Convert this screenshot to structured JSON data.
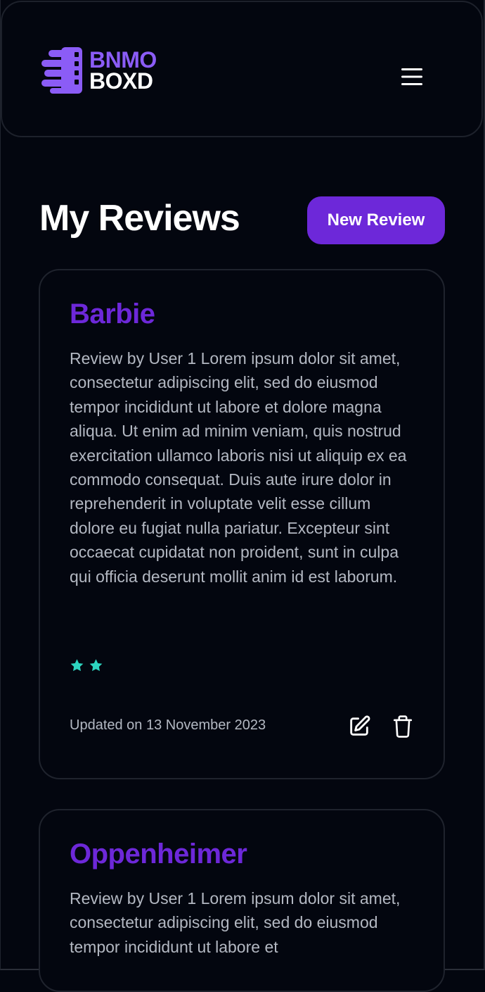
{
  "app": {
    "logo_line_1": "BNMO",
    "logo_line_2": "BOXD",
    "brand_color": "#8b5cf6",
    "menu_icon": "hamburger-menu-icon"
  },
  "page": {
    "title": "My Reviews",
    "new_review_label": "New Review",
    "accent_color": "#6d28d9"
  },
  "reviews": [
    {
      "title": "Barbie",
      "body": "Review by User 1 Lorem ipsum dolor sit amet, consectetur adipiscing elit, sed do eiusmod tempor incididunt ut labore et dolore magna aliqua. Ut enim ad minim veniam, quis nostrud exercitation ullamco laboris nisi ut aliquip ex ea commodo consequat. Duis aute irure dolor in reprehenderit in voluptate velit esse cillum dolore eu fugiat nulla pariatur. Excepteur sint occaecat cupidatat non proident, sunt in culpa qui officia deserunt mollit anim id est laborum.",
      "rating": 2,
      "star_color": "#2dd4bf",
      "updated": "Updated on 13 November 2023",
      "edit_icon": "edit-icon",
      "delete_icon": "trash-icon"
    },
    {
      "title": "Oppenheimer",
      "body": "Review by User 1 Lorem ipsum dolor sit amet, consectetur adipiscing elit, sed do eiusmod tempor incididunt ut labore et"
    }
  ]
}
